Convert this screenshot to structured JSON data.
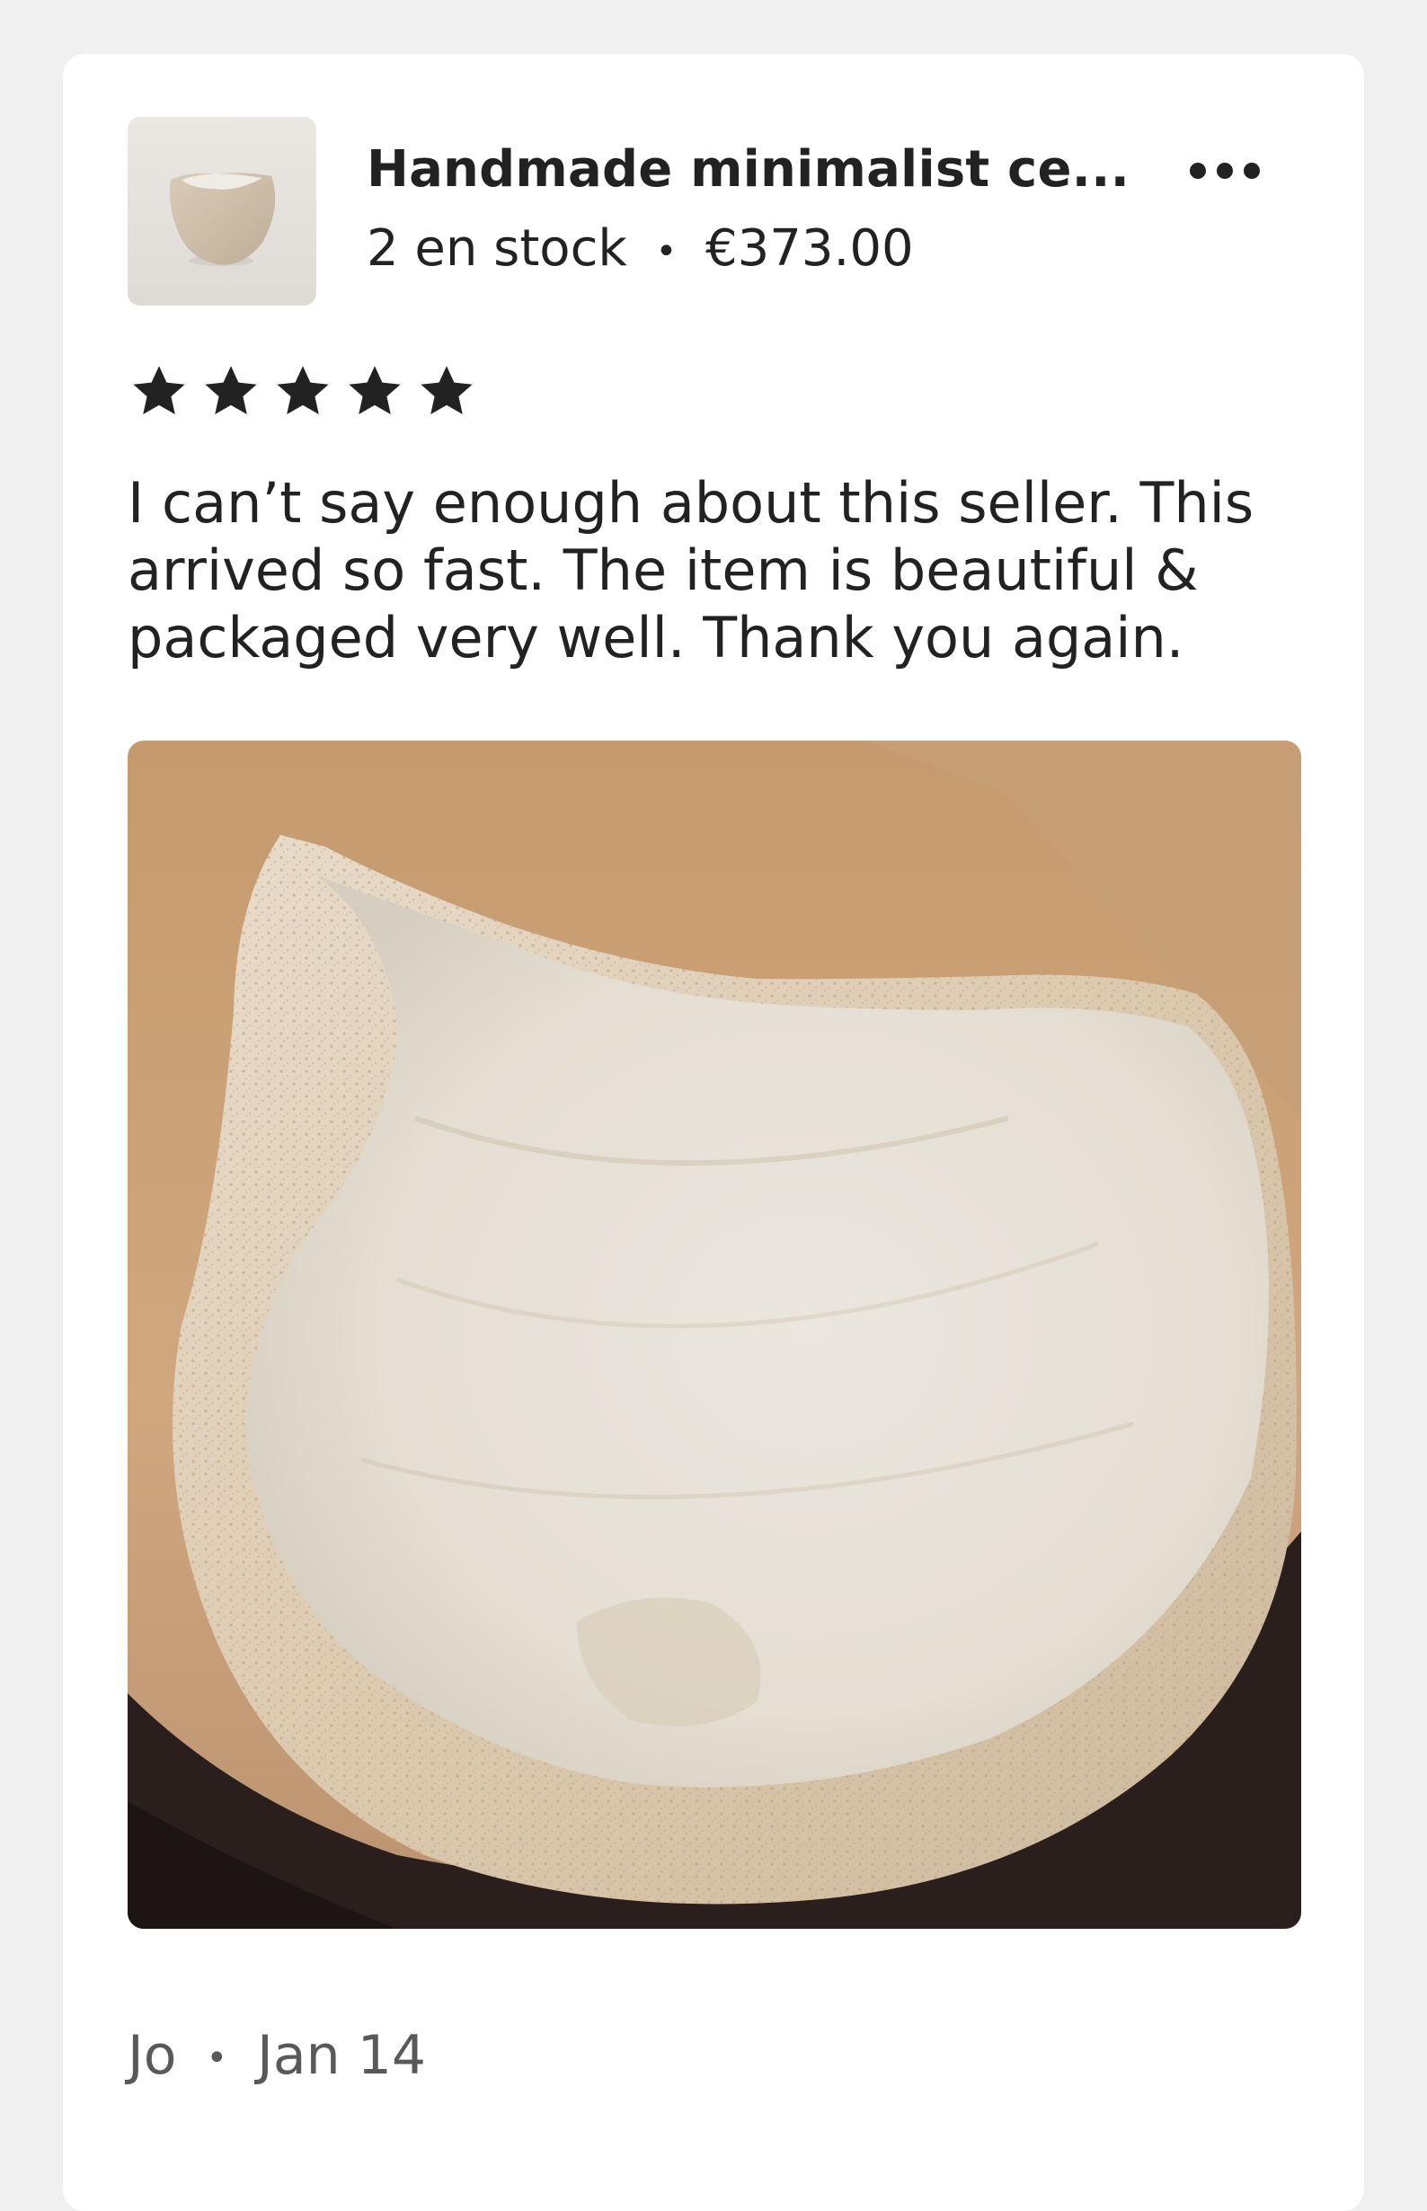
{
  "listing": {
    "title": "Handmade minimalist ce...",
    "stock": "2 en stock",
    "separator": "•",
    "price": "€373.00",
    "thumbnail_icon": "ceramic-vessel-thumbnail"
  },
  "menu": {
    "icon": "more-options-icon"
  },
  "review": {
    "rating": 5,
    "rating_max": 5,
    "text": "I can’t say enough about this seller. This arrived so fast. The item is beautiful & packaged very well. Thank you again.",
    "author": "Jo",
    "separator": "•",
    "date": "Jan 14"
  },
  "colors": {
    "background": "#f0f0f0",
    "card": "#ffffff",
    "text": "#222222",
    "muted_text": "#595959",
    "star": "#222222"
  }
}
